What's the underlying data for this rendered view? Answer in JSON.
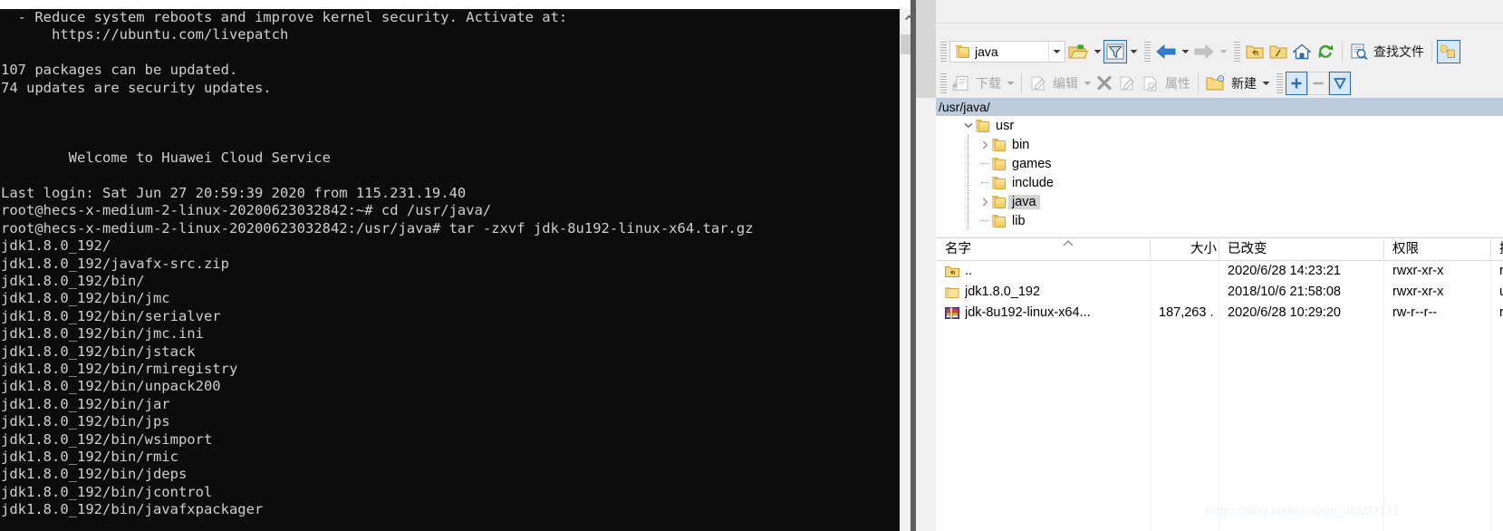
{
  "terminal": {
    "lines": [
      "  - Reduce system reboots and improve kernel security. Activate at:",
      "      https://ubuntu.com/livepatch",
      "",
      "107 packages can be updated.",
      "74 updates are security updates.",
      "",
      "",
      "",
      "        Welcome to Huawei Cloud Service",
      "",
      "Last login: Sat Jun 27 20:59:39 2020 from 115.231.19.40",
      "root@hecs-x-medium-2-linux-20200623032842:~# cd /usr/java/",
      "root@hecs-x-medium-2-linux-20200623032842:/usr/java# tar -zxvf jdk-8u192-linux-x64.tar.gz",
      "jdk1.8.0_192/",
      "jdk1.8.0_192/javafx-src.zip",
      "jdk1.8.0_192/bin/",
      "jdk1.8.0_192/bin/jmc",
      "jdk1.8.0_192/bin/serialver",
      "jdk1.8.0_192/bin/jmc.ini",
      "jdk1.8.0_192/bin/jstack",
      "jdk1.8.0_192/bin/rmiregistry",
      "jdk1.8.0_192/bin/unpack200",
      "jdk1.8.0_192/bin/jar",
      "jdk1.8.0_192/bin/jps",
      "jdk1.8.0_192/bin/wsimport",
      "jdk1.8.0_192/bin/rmic",
      "jdk1.8.0_192/bin/jdeps",
      "jdk1.8.0_192/bin/jcontrol",
      "jdk1.8.0_192/bin/javafxpackager"
    ]
  },
  "sftp": {
    "toolbar1": {
      "location_combo_value": "java",
      "open_folder_icon": "open-folder-icon",
      "filter_icon": "filter-icon",
      "back_icon": "back-arrow-icon",
      "forward_icon": "forward-arrow-icon",
      "parent_dir_icon": "up-folder-icon",
      "root_dir_icon": "root-folder-icon",
      "home_icon": "home-icon",
      "refresh_icon": "refresh-icon",
      "find_icon": "find-file-icon",
      "find_label": "查找文件",
      "sync_browse_icon": "synchronize-browsing-icon"
    },
    "toolbar2": {
      "download_icon": "download-icon",
      "download_label": "下载",
      "edit_icon": "edit-icon",
      "edit_label": "编辑",
      "delete_icon": "delete-icon",
      "rename_icon": "rename-icon",
      "duplicate_icon": "duplicate-icon",
      "properties_label": "属性",
      "new_icon": "new-folder-icon",
      "new_label": "新建",
      "select_add_icon": "select-plus-icon",
      "select_remove_icon": "select-minus-icon",
      "select_filter_icon": "select-filter-icon"
    },
    "path": "/usr/java/",
    "tree": [
      {
        "label": "usr",
        "depth": 0,
        "expander": "down",
        "selected": false
      },
      {
        "label": "bin",
        "depth": 1,
        "expander": "right",
        "selected": false
      },
      {
        "label": "games",
        "depth": 1,
        "expander": "none",
        "selected": false
      },
      {
        "label": "include",
        "depth": 1,
        "expander": "none",
        "selected": false
      },
      {
        "label": "java",
        "depth": 1,
        "expander": "right",
        "selected": true
      },
      {
        "label": "lib",
        "depth": 1,
        "expander": "none",
        "selected": false
      }
    ],
    "columns": [
      {
        "label": "名字",
        "align": "left"
      },
      {
        "label": "大小",
        "align": "right"
      },
      {
        "label": "已改变",
        "align": "left"
      },
      {
        "label": "权限",
        "align": "left"
      },
      {
        "label": "拥有",
        "align": "left"
      }
    ],
    "rows": [
      {
        "icon": "parent-dir-icon",
        "name": "..",
        "size": "",
        "changed": "2020/6/28 14:23:21",
        "perms": "rwxr-xr-x",
        "owner": "roo"
      },
      {
        "icon": "folder-icon",
        "name": "jdk1.8.0_192",
        "size": "",
        "changed": "2018/10/6 21:58:08",
        "perms": "rwxr-xr-x",
        "owner": "uu"
      },
      {
        "icon": "archive-icon",
        "name": "jdk-8u192-linux-x64...",
        "size": "187,263 ...",
        "changed": "2020/6/28 10:29:20",
        "perms": "rw-r--r--",
        "owner": "roo"
      }
    ]
  },
  "watermark": "https://blog.csdn.net/qq_40693171"
}
